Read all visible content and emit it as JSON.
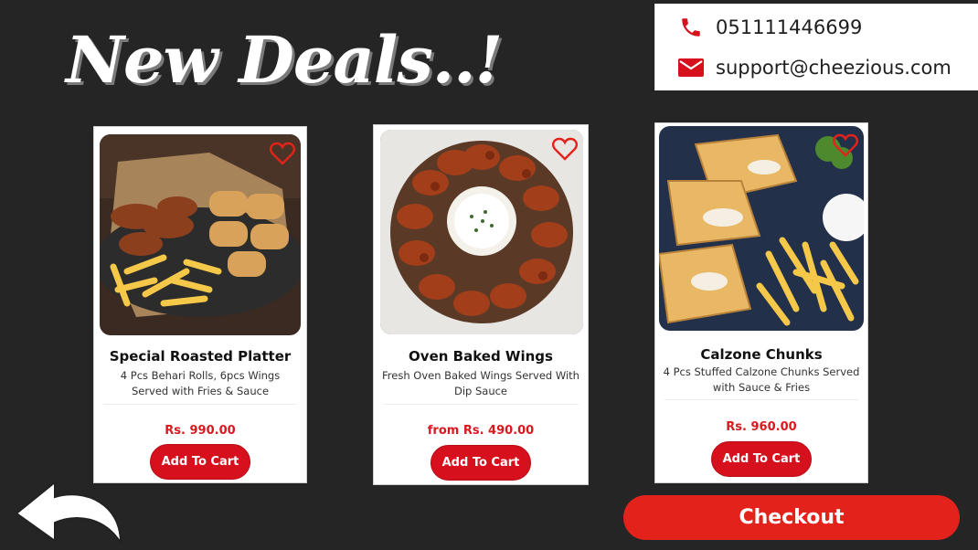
{
  "banner": {
    "title": "New Deals..!"
  },
  "contact": {
    "phone": "051111446699",
    "email": "support@cheezious.com",
    "phone_icon": "phone-icon",
    "email_icon": "mail-icon"
  },
  "colors": {
    "background": "#262525",
    "accent_red": "#d6101c",
    "price_red": "#d8191f",
    "checkout_red": "#e3231b"
  },
  "deals": [
    {
      "name": "Special Roasted Platter",
      "desc": "4 Pcs Behari Rolls, 6pcs Wings Served with Fries & Sauce",
      "price": "Rs. 990.00",
      "button": "Add To Cart"
    },
    {
      "name": "Oven Baked Wings",
      "desc": "Fresh Oven Baked Wings Served With Dip Sauce",
      "price": "from Rs. 490.00",
      "button": "Add To Cart"
    },
    {
      "name": "Calzone Chunks",
      "desc": "4 Pcs Stuffed Calzone Chunks Served with Sauce & Fries",
      "price": "Rs. 960.00",
      "button": "Add To Cart"
    }
  ],
  "checkout": {
    "label": "Checkout"
  },
  "icons": {
    "favorite": "heart-outline-icon",
    "back": "back-arrow-icon"
  }
}
